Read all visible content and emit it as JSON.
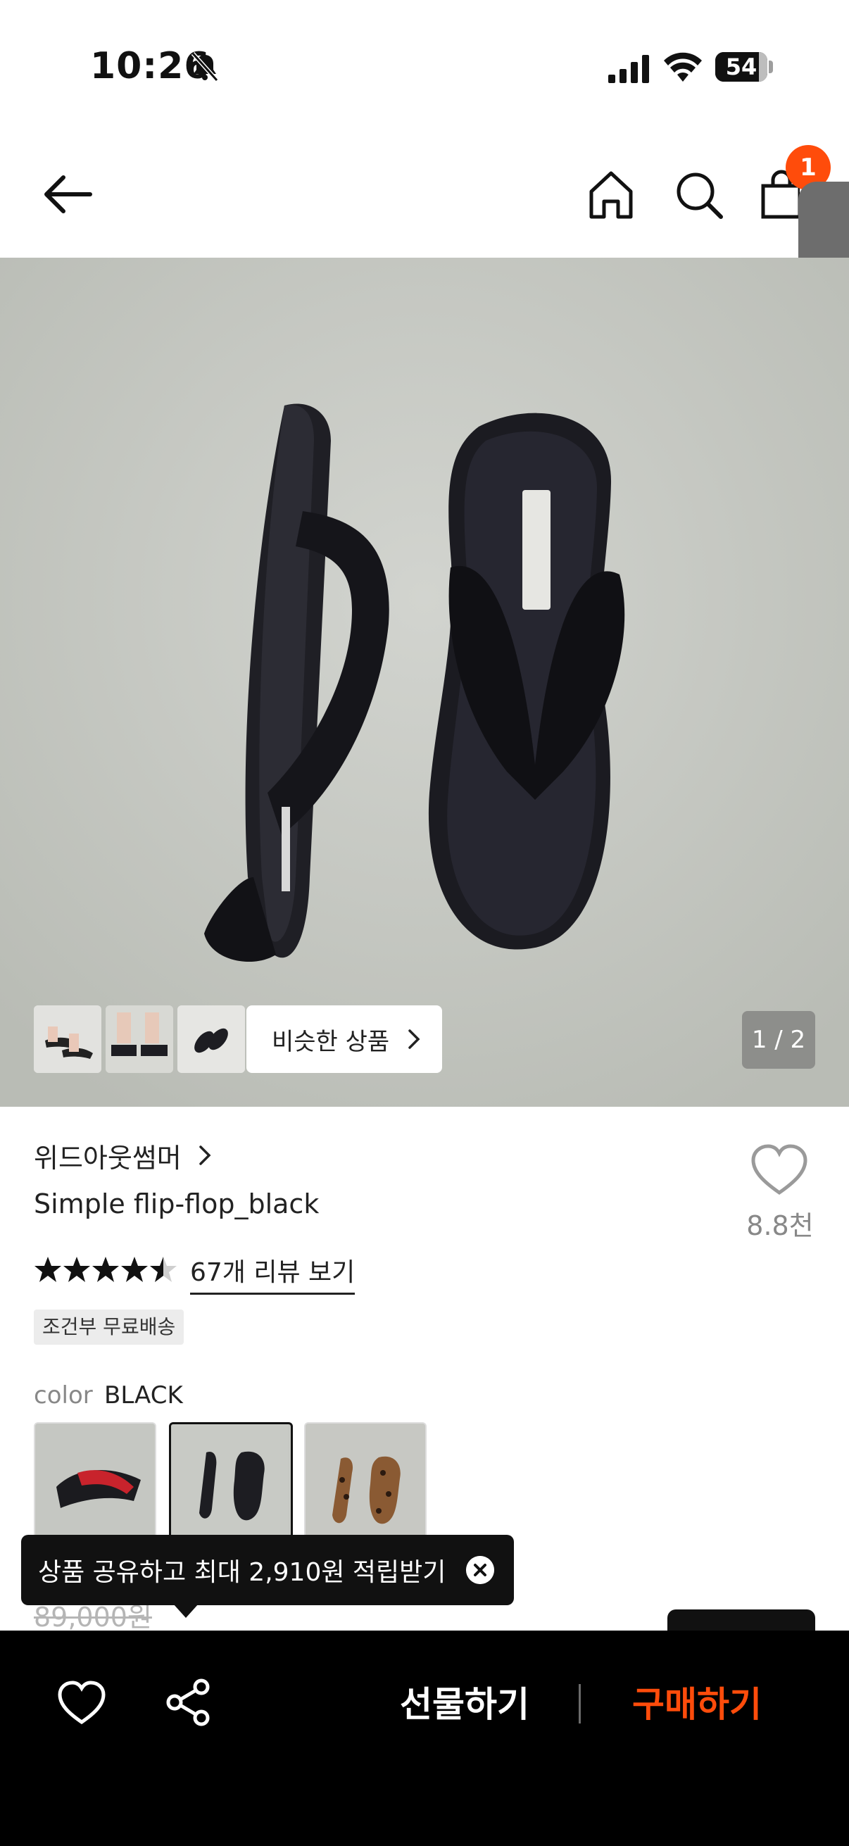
{
  "status_bar": {
    "time": "10:26",
    "battery": "54"
  },
  "nav": {
    "cart_count": "1"
  },
  "hero": {
    "similar_label": "비슷한 상품",
    "page_counter": "1 / 2"
  },
  "product": {
    "brand": "위드아웃썸머",
    "title": "Simple flip-flop_black",
    "likes": "8.8천",
    "rating": 4.5,
    "review_link": "67개 리뷰 보기",
    "shipping_badge": "조건부 무료배송",
    "color_label": "color",
    "color_value": "BLACK",
    "original_price": "89,000원"
  },
  "tooltip": {
    "text": "상품 공유하고 최대 2,910원 적립받기"
  },
  "bottom_bar": {
    "gift_label": "선물하기",
    "buy_label": "구매하기"
  },
  "colors": {
    "accent": "#ff4c0b",
    "bar": "#000000"
  }
}
